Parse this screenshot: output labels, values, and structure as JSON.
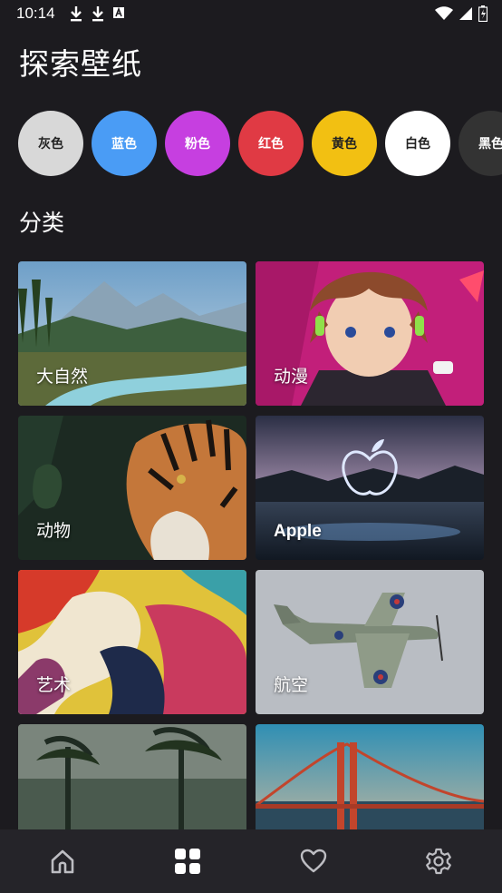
{
  "status_bar": {
    "time": "10:14",
    "left_icons": [
      "download-icon",
      "download-icon",
      "font-icon"
    ],
    "right_icons": [
      "wifi-icon",
      "signal-icon",
      "battery-icon"
    ]
  },
  "page_title": "探索壁纸",
  "colors": [
    {
      "label": "灰色",
      "bg": "#d8d8d8",
      "text": "#222222"
    },
    {
      "label": "蓝色",
      "bg": "#4a9cf5",
      "text": "#ffffff"
    },
    {
      "label": "粉色",
      "bg": "#c63fe0",
      "text": "#ffffff"
    },
    {
      "label": "红色",
      "bg": "#e03a44",
      "text": "#ffffff"
    },
    {
      "label": "黄色",
      "bg": "#f2c012",
      "text": "#222222"
    },
    {
      "label": "白色",
      "bg": "#ffffff",
      "text": "#222222"
    },
    {
      "label": "黑色",
      "bg": "#333333",
      "text": "#ffffff"
    }
  ],
  "section_title": "分类",
  "categories": [
    {
      "label": "大自然"
    },
    {
      "label": "动漫"
    },
    {
      "label": "动物"
    },
    {
      "label": "Apple"
    },
    {
      "label": "艺术"
    },
    {
      "label": "航空"
    },
    {
      "label": ""
    },
    {
      "label": ""
    }
  ],
  "bottom_nav": [
    "home-icon",
    "grid-icon",
    "heart-icon",
    "settings-icon"
  ]
}
